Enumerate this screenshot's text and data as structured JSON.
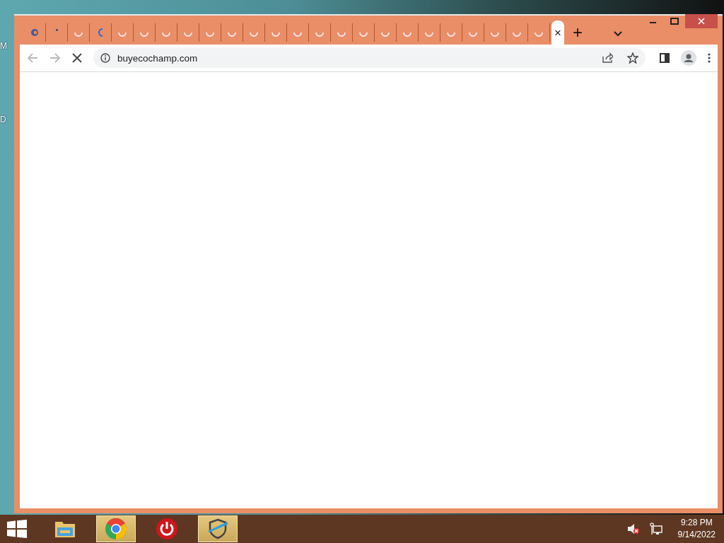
{
  "desktop": {
    "icon_labels": [
      "M",
      "D"
    ]
  },
  "browser": {
    "tabs": [
      {
        "kind": "favicon",
        "selected": false
      },
      {
        "kind": "dot",
        "selected": false
      },
      {
        "kind": "spinner",
        "selected": false
      },
      {
        "kind": "partial",
        "selected": false
      },
      {
        "kind": "spinner",
        "selected": false
      },
      {
        "kind": "spinner",
        "selected": false
      },
      {
        "kind": "spinner",
        "selected": false
      },
      {
        "kind": "spinner",
        "selected": false
      },
      {
        "kind": "spinner",
        "selected": false
      },
      {
        "kind": "spinner",
        "selected": false
      },
      {
        "kind": "spinner",
        "selected": false
      },
      {
        "kind": "spinner",
        "selected": false
      },
      {
        "kind": "spinner",
        "selected": false
      },
      {
        "kind": "spinner",
        "selected": false
      },
      {
        "kind": "spinner",
        "selected": false
      },
      {
        "kind": "spinner",
        "selected": false
      },
      {
        "kind": "spinner",
        "selected": false
      },
      {
        "kind": "spinner",
        "selected": false
      },
      {
        "kind": "spinner",
        "selected": false
      },
      {
        "kind": "spinner",
        "selected": false
      },
      {
        "kind": "spinner",
        "selected": false
      },
      {
        "kind": "spinner",
        "selected": false
      },
      {
        "kind": "spinner",
        "selected": false
      },
      {
        "kind": "spinner",
        "selected": false
      },
      {
        "kind": "close",
        "close": "×",
        "selected": true
      }
    ],
    "new_tab": "+",
    "url": "buyecochamp.com",
    "loading": true
  },
  "taskbar": {
    "items": [
      {
        "kind": "explorer",
        "selected": false
      },
      {
        "kind": "chrome",
        "selected": true
      },
      {
        "kind": "power",
        "selected": false
      },
      {
        "kind": "shield",
        "selected": true
      }
    ],
    "time": "9:28 PM",
    "date": "9/14/2022"
  }
}
